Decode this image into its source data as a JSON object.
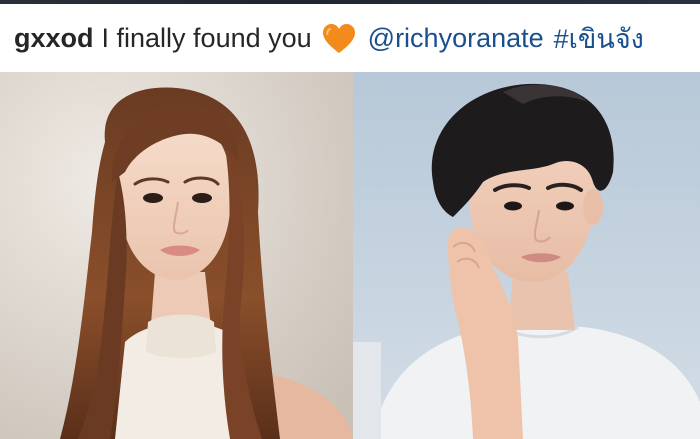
{
  "post": {
    "username": "gxxod",
    "caption": "I finally found you",
    "emoji_icon": "orange-heart-icon",
    "mention": "@richyoranate",
    "hashtag": "#เขินจัง"
  },
  "colors": {
    "text": "#262626",
    "link": "#1a4f8f",
    "heart": "#f28a1c"
  },
  "photos": [
    {
      "description_icon": "portrait-woman-photo"
    },
    {
      "description_icon": "portrait-man-photo"
    }
  ]
}
